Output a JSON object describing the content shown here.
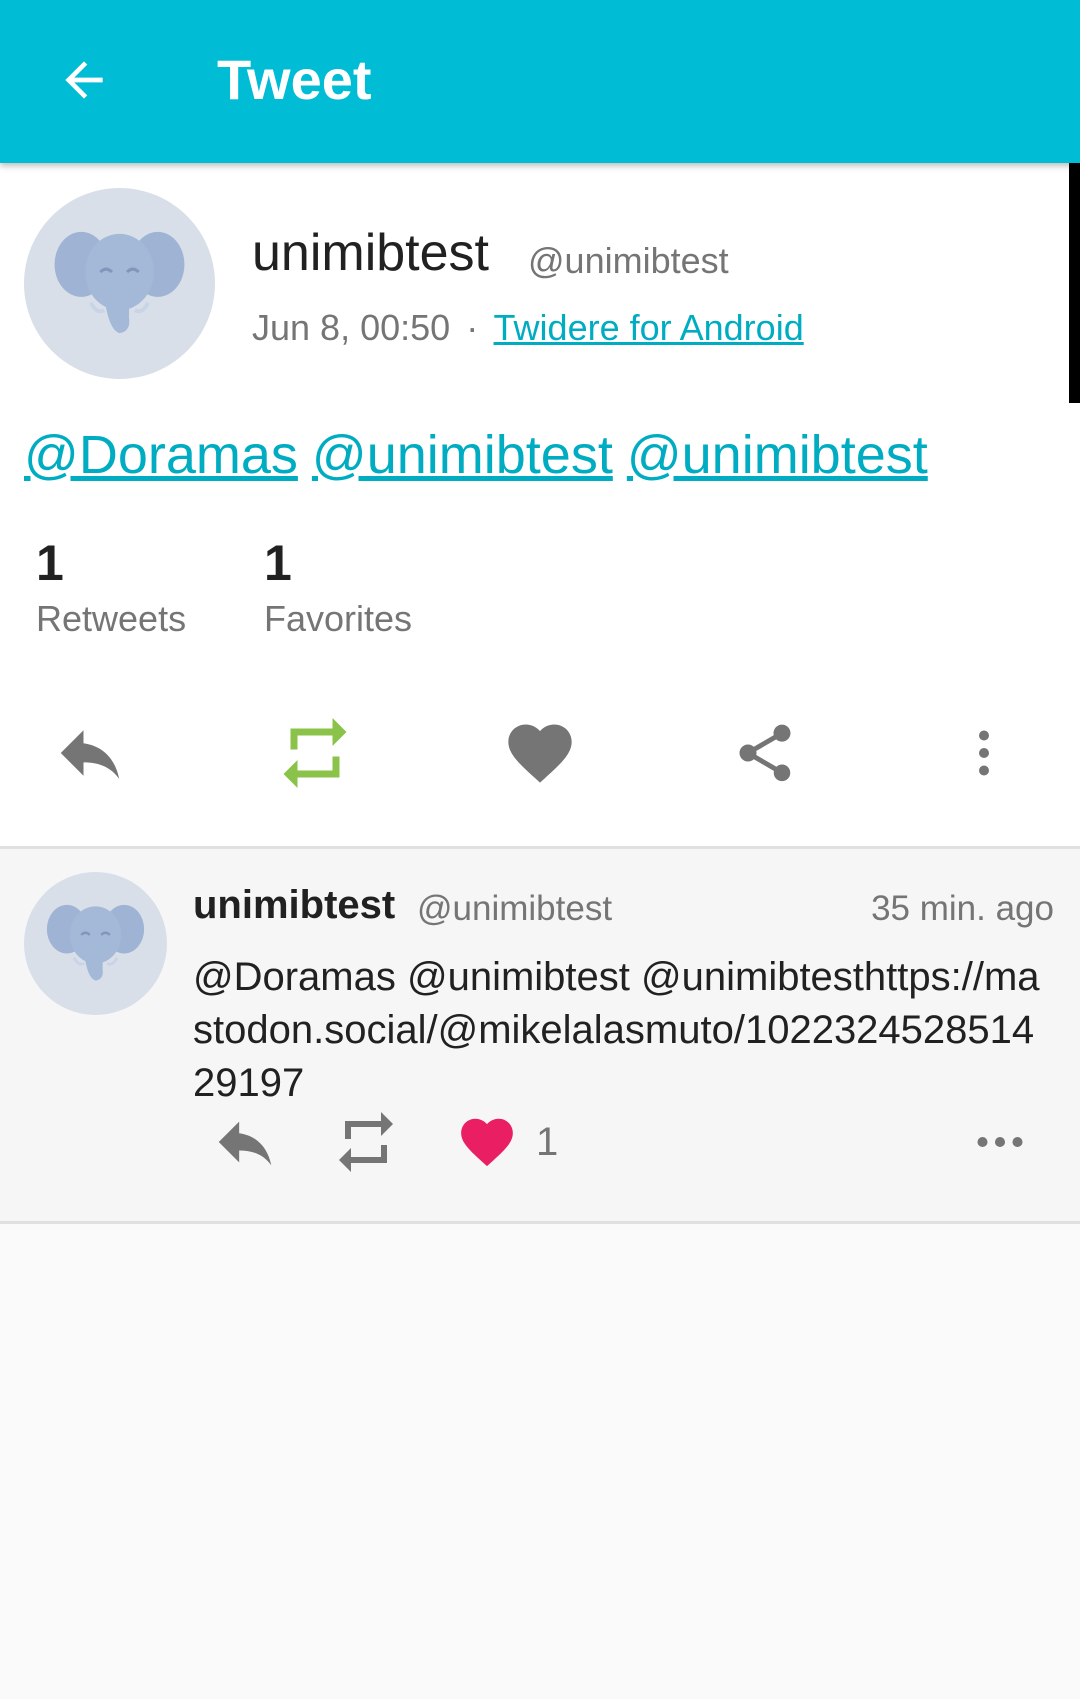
{
  "appbar": {
    "title": "Tweet"
  },
  "status": {
    "display_name": "unimibtest",
    "handle": "@unimibtest",
    "timestamp": "Jun 8, 00:50",
    "separator": "·",
    "source": "Twidere for Android",
    "mentions": [
      "@Doramas",
      "@unimibtest",
      "@unimibtest"
    ],
    "retweets": {
      "count": "1",
      "label": "Retweets"
    },
    "favorites": {
      "count": "1",
      "label": "Favorites"
    }
  },
  "actions": [
    "reply-icon",
    "retweet-icon",
    "favorite-icon",
    "share-icon",
    "more-vertical-icon"
  ],
  "colors": {
    "appbar": "#00bcd4",
    "link": "#00acc1",
    "retweet_active": "#8bc34a",
    "like_active": "#e91e63",
    "icon": "#757575"
  },
  "reply": {
    "display_name": "unimibtest",
    "handle": "@unimibtest",
    "time": "35 min. ago",
    "text": "@Doramas @unimibtest @unimibtesthttps://mastodon.social/@mikelalasmuto/102232452851429197",
    "like_count": "1"
  }
}
